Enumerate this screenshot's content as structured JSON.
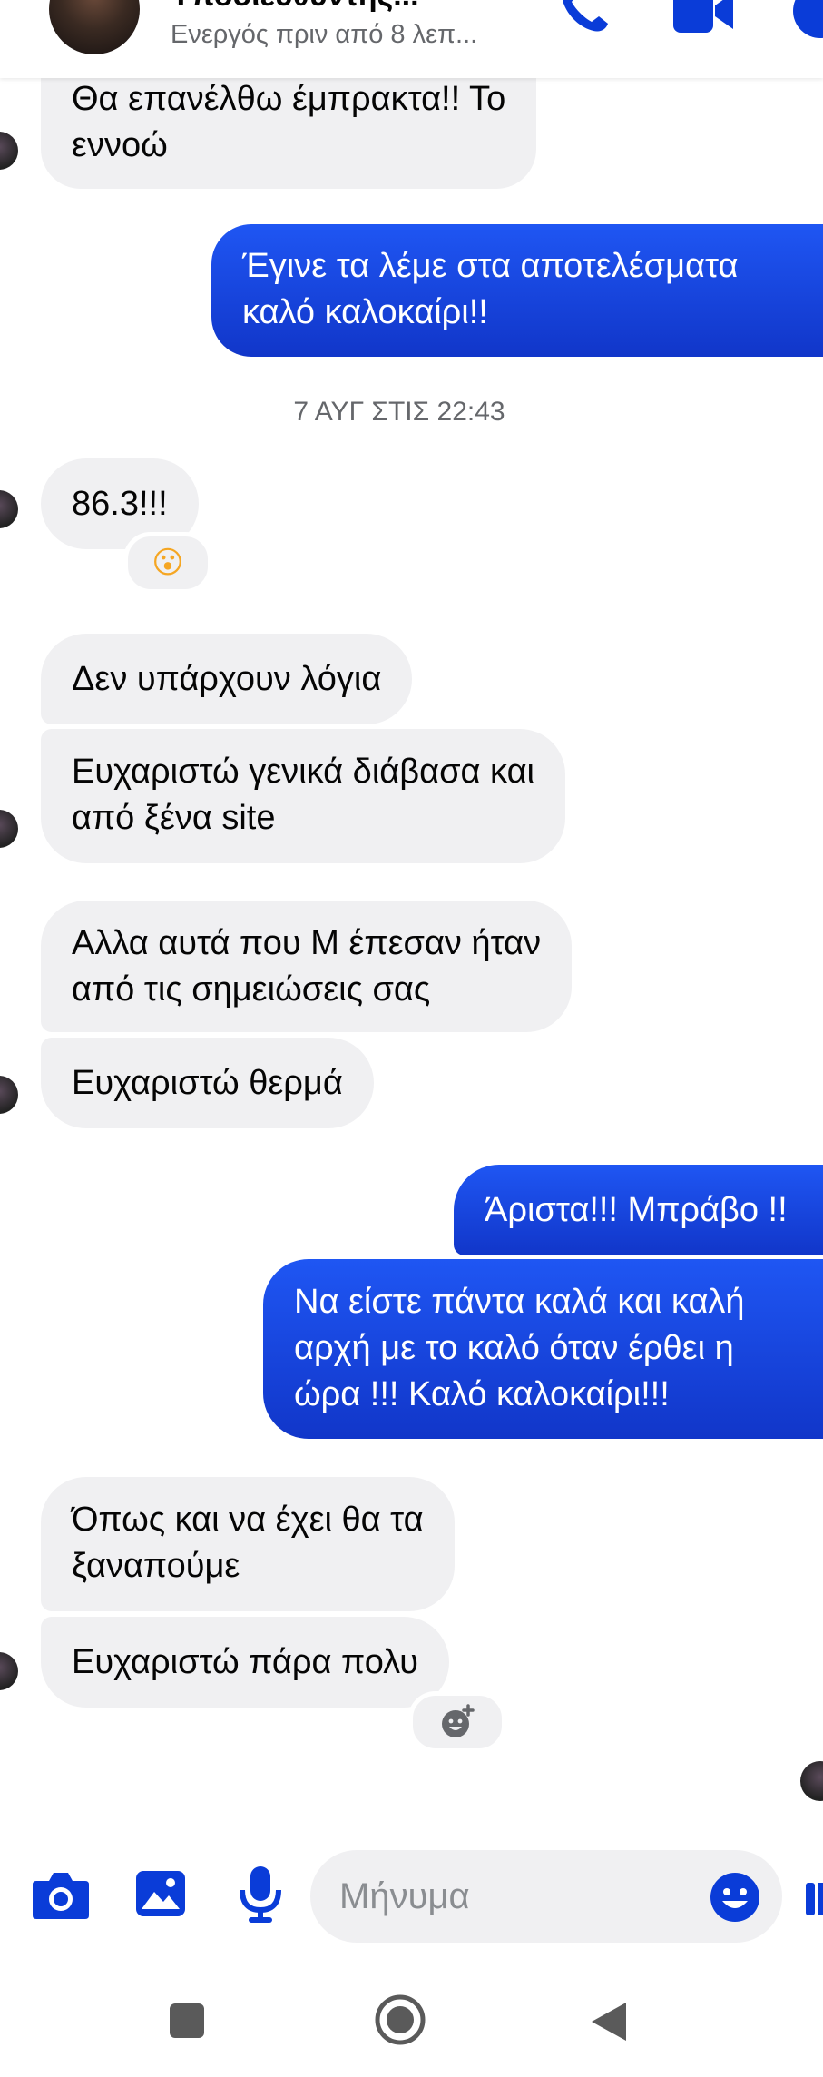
{
  "header": {
    "contact_name": "Υποδιευθυντής...",
    "status": "Ενεργός πριν από 8 λεπ..."
  },
  "timestamp": "7 ΑΥΓ ΣΤΙΣ 22:43",
  "messages": [
    {
      "dir": "in",
      "text": "Θα επανέλθω έμπρακτα!! Το\nεννοώ"
    },
    {
      "dir": "out",
      "text": "Έγινε τα λέμε στα αποτελέσματα\nκαλό καλοκαίρι!!"
    },
    {
      "dir": "in",
      "text": "86.3!!!"
    },
    {
      "dir": "in",
      "text": "Δεν υπάρχουν λόγια"
    },
    {
      "dir": "in",
      "text": "Ευχαριστώ γενικά διάβασα και\nαπό ξένα site"
    },
    {
      "dir": "in",
      "text": "Αλλα αυτά που Μ έπεσαν ήταν\nαπό τις σημειώσεις σας"
    },
    {
      "dir": "in",
      "text": "Ευχαριστώ θερμά"
    },
    {
      "dir": "out",
      "text": "Άριστα!!! Μπράβο !!"
    },
    {
      "dir": "out",
      "text": "Να είστε πάντα καλά και καλή\nαρχή με το καλό όταν έρθει η\nώρα !!! Καλό καλοκαίρι!!!"
    },
    {
      "dir": "in",
      "text": "Όπως και να έχει θα τα\nξαναπούμε"
    },
    {
      "dir": "in",
      "text": "Ευχαριστώ πάρα πολυ"
    }
  ],
  "reactions": {
    "surprised": "😮"
  },
  "composer": {
    "placeholder": "Μήνυμα"
  },
  "icons": {
    "phone": "phone-icon",
    "video": "video-call-icon",
    "info": "info-icon",
    "camera": "camera-icon",
    "gallery": "image-icon",
    "mic": "microphone-icon",
    "emoji": "emoji-icon",
    "like": "like-icon",
    "add_reaction": "add-reaction-icon"
  },
  "colors": {
    "accent": "#0a3cd8",
    "outgoing_bubble": "#1a4ae8",
    "incoming_bubble": "#f0f0f2",
    "secondary_text": "#65676b"
  }
}
